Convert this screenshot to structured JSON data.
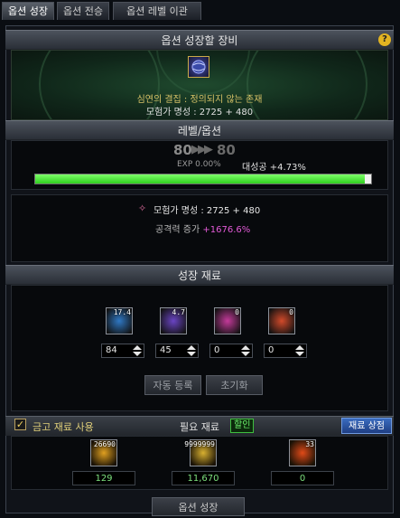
{
  "tabs": [
    {
      "label": "옵션 성장"
    },
    {
      "label": "옵션 전승"
    },
    {
      "label": "옵션 레벨 이관"
    }
  ],
  "equipment_section": {
    "title": "옵션 성장할 장비",
    "help": "?",
    "item_name": "심연의 결집 : 정의되지 않는 존재",
    "fame_text": "모험가 명성 : 2725 + 480"
  },
  "level_section": {
    "title": "레벨/옵션",
    "level_current": "80",
    "level_next": "80",
    "exp_text": "EXP 0.00%",
    "success_text": "대성공 +4.73%",
    "progress": 0.98,
    "fame_label": "모험가 명성 : 2725 + 480",
    "attack_label": "공격력 증가",
    "attack_value": "+1676.6%"
  },
  "materials_section": {
    "title": "성장 재료",
    "materials": [
      {
        "count": "17.4",
        "value": "84",
        "color": "#2f78c4"
      },
      {
        "count": "4.7",
        "value": "45",
        "color": "#6a44c4"
      },
      {
        "count": "0",
        "value": "0",
        "color": "#c43a9a"
      },
      {
        "count": "0",
        "value": "0",
        "color": "#d24a2a"
      }
    ],
    "auto_register": "자동 등록",
    "reset": "초기화"
  },
  "cost_section": {
    "use_storage_label": "금고 재료 사용",
    "needed_label": "필요 재료",
    "discount_badge": "할인",
    "shop_button": "재료 상점",
    "costs": [
      {
        "stock": "26690",
        "value": "129",
        "color": "#e0a020"
      },
      {
        "stock": "9999999",
        "value": "11,670",
        "color": "#d8b030"
      },
      {
        "stock": "33",
        "value": "0",
        "color": "#e04a18"
      }
    ]
  },
  "footer": {
    "grow_button": "옵션 성장"
  }
}
